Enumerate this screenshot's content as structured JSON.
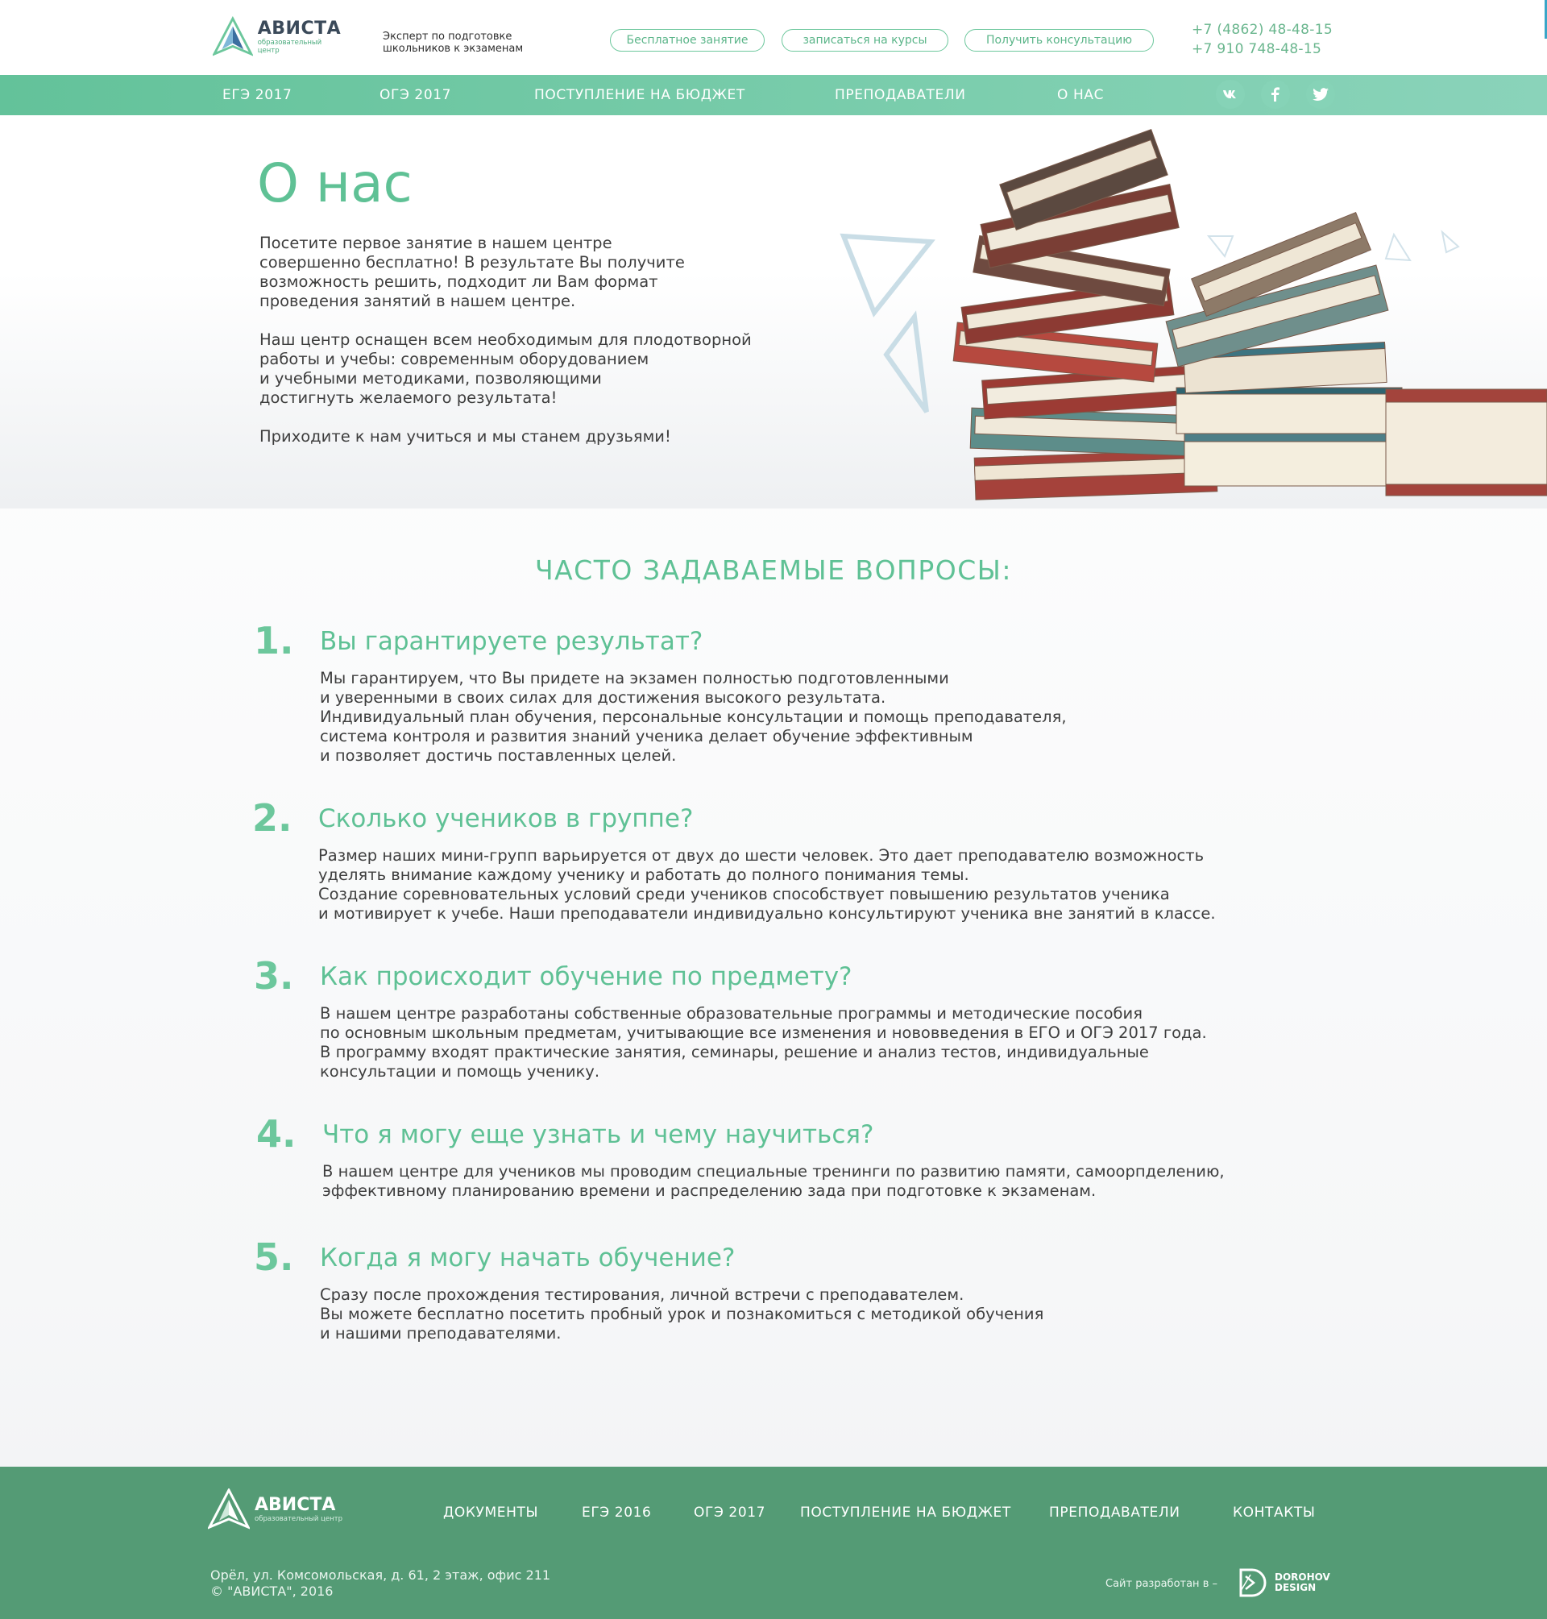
{
  "header": {
    "logo_name": "АВИСТА",
    "logo_sub": "образовательный центр",
    "tagline_line1": "Эксперт по подготовке",
    "tagline_line2": "школьников к экзаменам",
    "buttons": [
      "Бесплатное занятие",
      "записаться на курсы",
      "Получить консультацию"
    ],
    "phones": [
      "+7 (4862) 48-48-15",
      "+7 910 748-48-15"
    ]
  },
  "nav": {
    "items": [
      "ЕГЭ 2017",
      "ОГЭ 2017",
      "ПОСТУПЛЕНИЕ НА БЮДЖЕТ",
      "ПРЕПОДАВАТЕЛИ",
      "О НАС"
    ],
    "social": [
      "vk-icon",
      "facebook-icon",
      "twitter-icon"
    ]
  },
  "hero": {
    "title": "О нас",
    "paragraphs": [
      "Посетите первое занятие в нашем центре\nсовершенно бесплатно! В результате Вы получите\nвозможность решить, подходит ли Вам формат\nпроведения занятий в нашем центре.",
      "Наш центр оснащен всем необходимым для плодотворной\nработы и учебы: современным оборудованием\nи учебными методиками, позволяющими\nдостигнуть желаемого результата!",
      "Приходите к нам учиться и мы станем друзьями!"
    ]
  },
  "faq": {
    "title": "ЧАСТО ЗАДАВАЕМЫЕ ВОПРОСЫ:",
    "items": [
      {
        "num": "1.",
        "question": "Вы гарантируете результат?",
        "answer": "Мы гарантируем, что Вы придете на экзамен полностью подготовленными\nи уверенными в своих силах для достижения высокого результата.\nИндивидуальный план обучения, персональные консультации и помощь преподавателя,\nсистема контроля и развития знаний ученика делает обучение эффективным\nи позволяет достичь поставленных целей."
      },
      {
        "num": "2.",
        "question": "Сколько учеников в группе?",
        "answer": "Размер наших мини-групп варьируется от двух до шести человек. Это дает преподавателю возможность\nуделять внимание каждому ученику и работать до полного понимания темы.\nСоздание соревновательных условий среди учеников способствует повышению результатов ученика\nи мотивирует к учебе. Наши преподаватели индивидуально консультируют ученика вне занятий в классе."
      },
      {
        "num": "3.",
        "question": "Как происходит обучение по предмету?",
        "answer": "В нашем центре разработаны собственные образовательные программы и методические пособия\nпо основным школьным предметам, учитывающие все изменения и нововведения в ЕГО и ОГЭ 2017 года.\nВ программу входят практические занятия, семинары, решение и анализ тестов, индивидуальные\nконсультации и помощь ученику."
      },
      {
        "num": "4.",
        "question": "Что я могу еще узнать и чему научиться?",
        "answer": "В нашем центре для учеников мы проводим специальные тренинги по развитию памяти, самоорпделению,\nэффективному планированию времени и распределению зада при подготовке к экзаменам."
      },
      {
        "num": "5.",
        "question": "Когда я могу начать обучение?",
        "answer": "Сразу после прохождения тестирования, личной встречи с преподавателем.\nВы можете бесплатно посетить пробный урок и познакомиться с методикой обучения\nи нашими преподавателями."
      }
    ]
  },
  "footer": {
    "logo_name": "АВИСТА",
    "logo_sub": "образовательный центр",
    "nav": [
      "ДОКУМЕНТЫ",
      "ЕГЭ 2016",
      "ОГЭ 2017",
      "ПОСТУПЛЕНИЕ НА БЮДЖЕТ",
      "ПРЕПОДАВАТЕЛИ",
      "КОНТАКТЫ"
    ],
    "address": "Орёл, ул. Комсомольская, д. 61, 2 этаж, офис 211",
    "copyright": "© \"АВИСТА\", 2016",
    "developed_by": "Сайт разработан в –",
    "dev_name_line1": "DOROHOV",
    "dev_name_line2": "DESIGN"
  }
}
